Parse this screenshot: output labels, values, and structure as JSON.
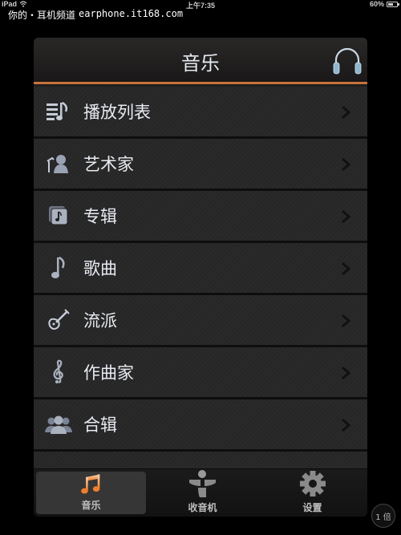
{
  "status_bar": {
    "device": "iPad",
    "time": "上午7:35",
    "battery": "60%",
    "battery_level": 0.6
  },
  "watermark": {
    "site_name": "你的・耳机频道",
    "url": "earphone.it168.com"
  },
  "header": {
    "title": "音乐",
    "right_icon": "headphones-icon"
  },
  "list": {
    "items": [
      {
        "label": "播放列表",
        "icon": "playlist-icon"
      },
      {
        "label": "艺术家",
        "icon": "artist-icon"
      },
      {
        "label": "专辑",
        "icon": "album-icon"
      },
      {
        "label": "歌曲",
        "icon": "song-icon"
      },
      {
        "label": "流派",
        "icon": "genre-icon"
      },
      {
        "label": "作曲家",
        "icon": "composer-icon"
      },
      {
        "label": "合辑",
        "icon": "compilation-icon"
      },
      {
        "label": "",
        "icon": "partial-icon"
      }
    ]
  },
  "tab_bar": {
    "tabs": [
      {
        "label": "音乐",
        "icon": "music-note-icon",
        "active": true
      },
      {
        "label": "收音机",
        "icon": "radio-icon",
        "active": false
      },
      {
        "label": "设置",
        "icon": "gear-icon",
        "active": false
      }
    ]
  },
  "zoom_badge": "1 倍",
  "colors": {
    "accent": "#c7733a",
    "active_tab_icon": "#f08a3c",
    "text": "#e8ecf2",
    "headphones": "#8fb6d0"
  }
}
